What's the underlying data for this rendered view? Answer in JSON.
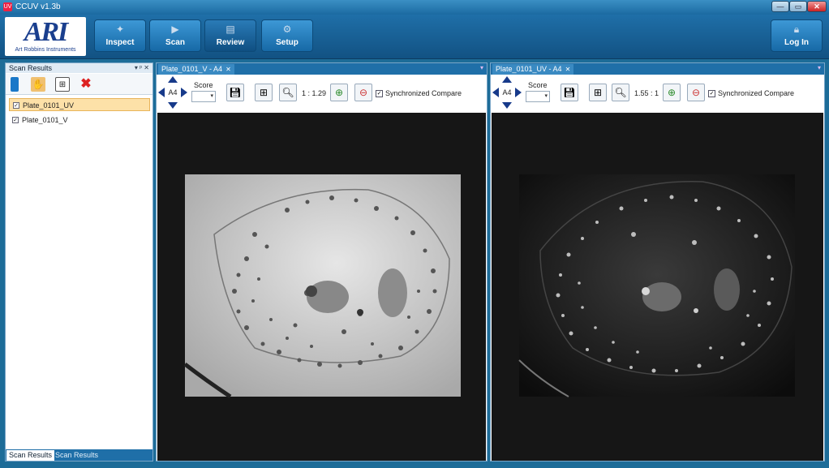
{
  "window": {
    "title": "CCUV v1.3b",
    "min": "—",
    "max": "▭",
    "close": "✕"
  },
  "ribbon": {
    "logo_text": "ARI",
    "logo_sub": "Art Robbins Instruments",
    "buttons": [
      {
        "label": "Inspect",
        "icon": "inspect-icon"
      },
      {
        "label": "Scan",
        "icon": "scan-icon"
      },
      {
        "label": "Review",
        "icon": "review-icon"
      },
      {
        "label": "Setup",
        "icon": "setup-icon"
      }
    ],
    "login": {
      "label": "Log In",
      "icon": "lock-icon"
    }
  },
  "scan_results": {
    "title": "Scan Results",
    "header_buttons": "▾ ᵖ ✕",
    "items": [
      {
        "label": "Plate_0101_UV",
        "checked": true,
        "selected": true
      },
      {
        "label": "Plate_0101_V",
        "checked": true,
        "selected": false
      }
    ],
    "tabs": [
      "Scan Results",
      "Scan Results"
    ]
  },
  "panes": [
    {
      "tab_label": "Plate_0101_V - A4",
      "well": "A4",
      "score_label": "Score",
      "zoom": "1 : 1.29",
      "sync_label": "Synchronized Compare",
      "sync_checked": true
    },
    {
      "tab_label": "Plate_0101_UV - A4",
      "well": "A4",
      "score_label": "Score",
      "zoom": "1.55 : 1",
      "sync_label": "Synchronized Compare",
      "sync_checked": true
    }
  ],
  "colors": {
    "ribbon": "#1f6fa8",
    "frame": "#1d6c98",
    "viewer_bg": "#161616"
  }
}
